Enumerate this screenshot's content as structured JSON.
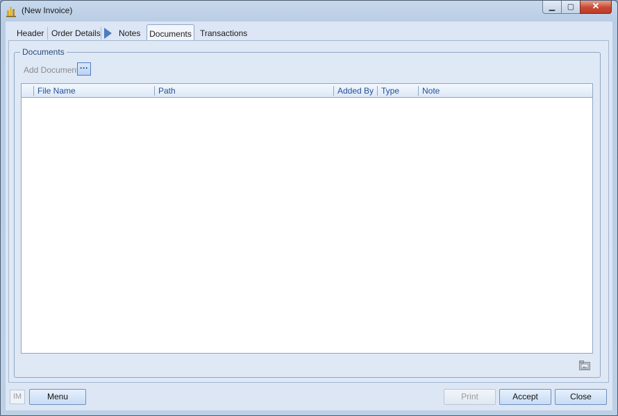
{
  "window": {
    "title": "(New Invoice)"
  },
  "title_controls": {
    "minimize": "▁",
    "maximize": "▢",
    "close": "✕"
  },
  "tabs": [
    {
      "label": "Header"
    },
    {
      "label": "Order Details"
    },
    {
      "label": "Notes"
    },
    {
      "label": "Documents"
    },
    {
      "label": "Transactions"
    }
  ],
  "active_tab": "Documents",
  "documents": {
    "group_title": "Documents",
    "add_document_label": "Add Document",
    "browse_button": "···",
    "columns": [
      "File Name",
      "Path",
      "Added By",
      "Type",
      "Note"
    ],
    "rows": []
  },
  "footer": {
    "im_label": "IM",
    "menu_label": "Menu",
    "print_label": "Print",
    "accept_label": "Accept",
    "close_label": "Close"
  },
  "icons": {
    "app": "bar-chart-icon",
    "attachment": "folder-image-icon"
  }
}
